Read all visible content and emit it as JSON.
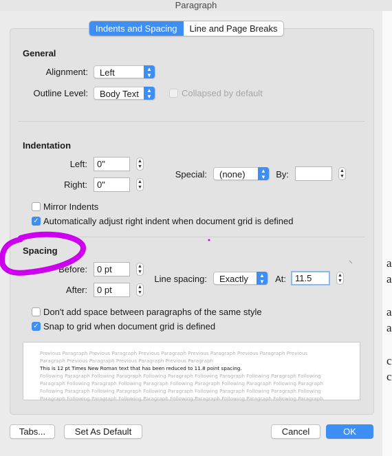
{
  "window": {
    "title": "Paragraph"
  },
  "tabs": [
    {
      "label": "Indents and Spacing",
      "active": true
    },
    {
      "label": "Line and Page Breaks",
      "active": false
    }
  ],
  "general": {
    "header": "General",
    "alignment_label": "Alignment:",
    "alignment_value": "Left",
    "outline_label": "Outline Level:",
    "outline_value": "Body Text",
    "collapsed_label": "Collapsed by default"
  },
  "indentation": {
    "header": "Indentation",
    "left_label": "Left:",
    "left_value": "0\"",
    "right_label": "Right:",
    "right_value": "0\"",
    "special_label": "Special:",
    "special_value": "(none)",
    "by_label": "By:",
    "by_value": "",
    "mirror_label": "Mirror Indents",
    "auto_adjust_label": "Automatically adjust right indent when document grid is defined"
  },
  "spacing": {
    "header": "Spacing",
    "before_label": "Before:",
    "before_value": "0 pt",
    "after_label": "After:",
    "after_value": "0 pt",
    "line_spacing_label": "Line spacing:",
    "line_spacing_value": "Exactly",
    "at_label": "At:",
    "at_value": "11.5",
    "dont_add_label": "Don't add space between paragraphs of the same style",
    "snap_label": "Snap to grid when document grid is defined"
  },
  "preview": {
    "lines": [
      "Previous Paragraph Previous Paragraph Previous Paragraph Previous Paragraph Previous Paragraph Previous",
      "Paragraph Previous Paragraph Previous Paragraph Previous Paragraph",
      "This is 12 pt Times New Roman text that has been reduced to 11.8 point spacing.",
      "Following Paragraph Following Paragraph Following Paragraph Following Paragraph Following Paragraph Following",
      "Paragraph Following Paragraph Following Paragraph Following Paragraph Following Paragraph Following Paragraph",
      "Following Paragraph Following Paragraph Following Paragraph Following Paragraph Following Paragraph Following",
      "Paragraph Following Paragraph Following Paragraph Following Paragraph Following Paragraph Following Paragraph"
    ]
  },
  "buttons": {
    "tabs": "Tabs...",
    "set_default": "Set As Default",
    "cancel": "Cancel",
    "ok": "OK"
  },
  "colors": {
    "accent": "#3d8ff5",
    "annotation": "#cc00ee"
  },
  "background_document": {
    "chars": [
      "a",
      "a",
      "a",
      "a",
      "c",
      "c"
    ]
  }
}
